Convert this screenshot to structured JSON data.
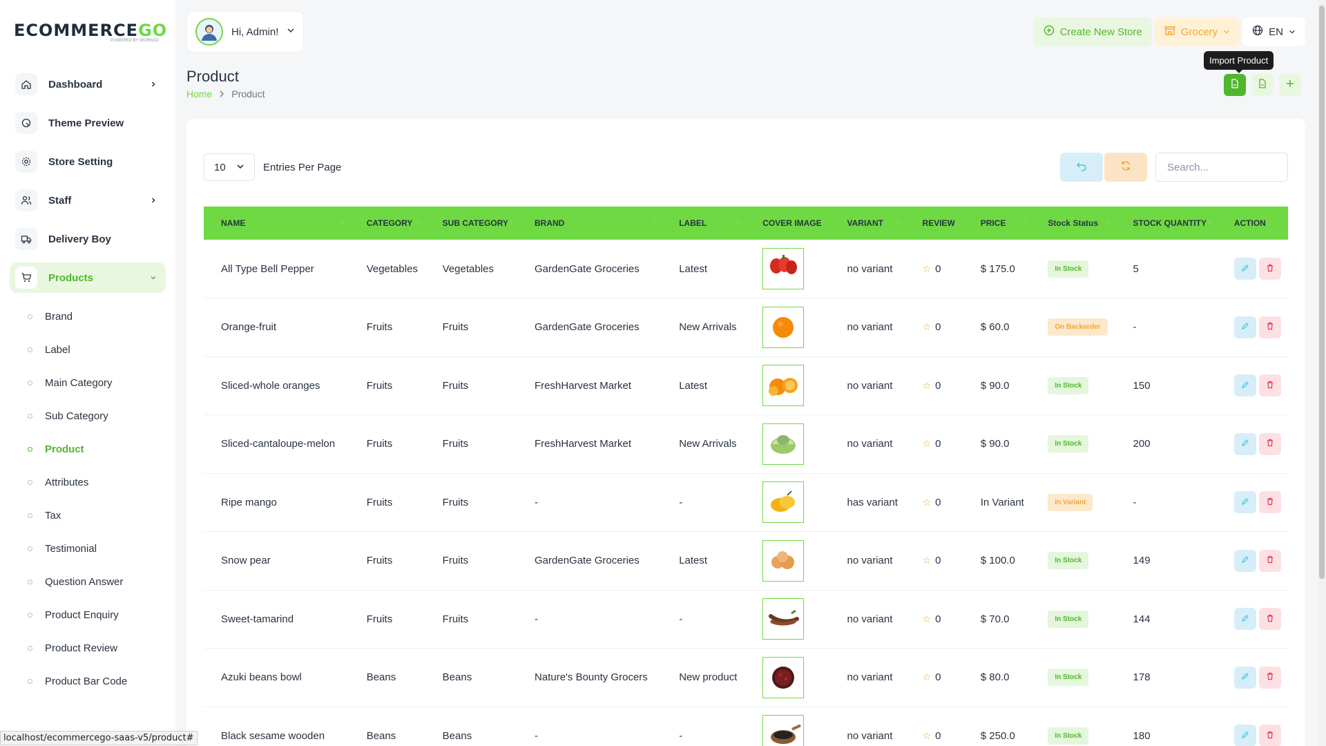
{
  "brand": {
    "logo_main": "ECOMMERCE",
    "logo_accent": "GO",
    "logo_sub": "POWERED BY WORKDO",
    "accent_color": "#6fd943"
  },
  "sidebar": {
    "items": [
      {
        "label": "Dashboard",
        "icon": "home-icon",
        "chevron": true
      },
      {
        "label": "Theme Preview",
        "icon": "theme-icon",
        "chevron": false
      },
      {
        "label": "Store Setting",
        "icon": "gear-icon",
        "chevron": false
      },
      {
        "label": "Staff",
        "icon": "users-icon",
        "chevron": true
      },
      {
        "label": "Delivery Boy",
        "icon": "truck-icon",
        "chevron": false
      },
      {
        "label": "Products",
        "icon": "cart-icon",
        "chevron": true
      }
    ],
    "sub_items": [
      "Brand",
      "Label",
      "Main Category",
      "Sub Category",
      "Product",
      "Attributes",
      "Tax",
      "Testimonial",
      "Question Answer",
      "Product Enquiry",
      "Product Review",
      "Product Bar Code"
    ]
  },
  "header": {
    "greeting": "Hi, Admin!",
    "create_store": "Create New Store",
    "store_select": "Grocery",
    "language": "EN"
  },
  "page": {
    "title": "Product",
    "breadcrumb_home": "Home",
    "breadcrumb_current": "Product",
    "tooltip": "Import Product"
  },
  "table": {
    "entries_value": "10",
    "entries_label": "Entries Per Page",
    "search_placeholder": "Search...",
    "headers": [
      "NAME",
      "CATEGORY",
      "SUB CATEGORY",
      "BRAND",
      "LABEL",
      "COVER IMAGE",
      "VARIANT",
      "REVIEW",
      "PRICE",
      "Stock Status",
      "STOCK QUANTITY",
      "ACTION"
    ],
    "rows": [
      {
        "name": "All Type Bell Pepper",
        "category": "Vegetables",
        "sub": "Vegetables",
        "brand": "GardenGate Groceries",
        "label": "Latest",
        "variant": "no variant",
        "review": "0",
        "price": "$ 175.0",
        "status": "In Stock",
        "status_kind": "in",
        "qty": "5",
        "img": "pepper"
      },
      {
        "name": "Orange-fruit",
        "category": "Fruits",
        "sub": "Fruits",
        "brand": "GardenGate Groceries",
        "label": "New Arrivals",
        "variant": "no variant",
        "review": "0",
        "price": "$ 60.0",
        "status": "On Backorder",
        "status_kind": "back",
        "qty": "-",
        "img": "orange"
      },
      {
        "name": "Sliced-whole oranges",
        "category": "Fruits",
        "sub": "Fruits",
        "brand": "FreshHarvest Market",
        "label": "Latest",
        "variant": "no variant",
        "review": "0",
        "price": "$ 90.0",
        "status": "In Stock",
        "status_kind": "in",
        "qty": "150",
        "img": "oranges"
      },
      {
        "name": "Sliced-cantaloupe-melon",
        "category": "Fruits",
        "sub": "Fruits",
        "brand": "FreshHarvest Market",
        "label": "New Arrivals",
        "variant": "no variant",
        "review": "0",
        "price": "$ 90.0",
        "status": "In Stock",
        "status_kind": "in",
        "qty": "200",
        "img": "melon"
      },
      {
        "name": "Ripe mango",
        "category": "Fruits",
        "sub": "Fruits",
        "brand": "-",
        "label": "-",
        "variant": "has variant",
        "review": "0",
        "price": "In Variant",
        "status": "In Variant",
        "status_kind": "var",
        "qty": "-",
        "img": "mango"
      },
      {
        "name": "Snow pear",
        "category": "Fruits",
        "sub": "Fruits",
        "brand": "GardenGate Groceries",
        "label": "Latest",
        "variant": "no variant",
        "review": "0",
        "price": "$ 100.0",
        "status": "In Stock",
        "status_kind": "in",
        "qty": "149",
        "img": "pear"
      },
      {
        "name": "Sweet-tamarind",
        "category": "Fruits",
        "sub": "Fruits",
        "brand": "-",
        "label": "-",
        "variant": "no variant",
        "review": "0",
        "price": "$ 70.0",
        "status": "In Stock",
        "status_kind": "in",
        "qty": "144",
        "img": "tamarind"
      },
      {
        "name": "Azuki beans bowl",
        "category": "Beans",
        "sub": "Beans",
        "brand": "Nature's Bounty Grocers",
        "label": "New product",
        "variant": "no variant",
        "review": "0",
        "price": "$ 80.0",
        "status": "In Stock",
        "status_kind": "in",
        "qty": "178",
        "img": "beans"
      },
      {
        "name": "Black sesame wooden",
        "category": "Beans",
        "sub": "Beans",
        "brand": "-",
        "label": "-",
        "variant": "no variant",
        "review": "0",
        "price": "$ 250.0",
        "status": "In Stock",
        "status_kind": "in",
        "qty": "180",
        "img": "sesame"
      }
    ]
  },
  "status_bar_url": "localhost/ecommercego-saas-v5/product#"
}
